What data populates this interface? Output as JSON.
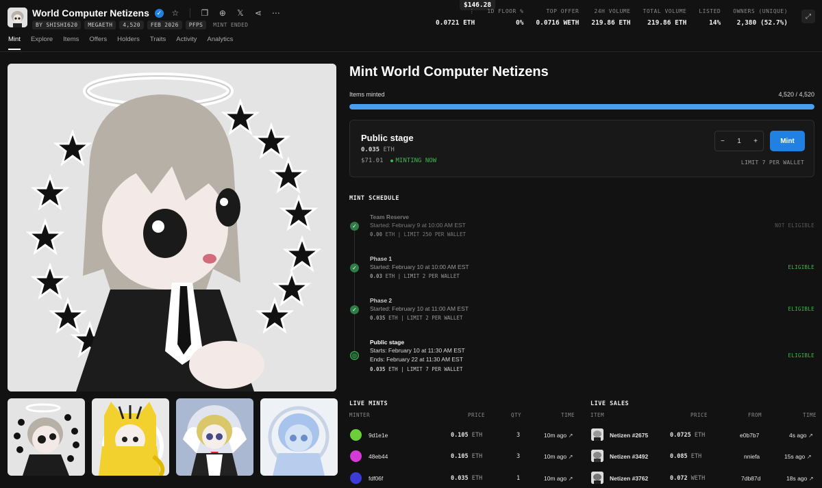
{
  "header": {
    "collection_name": "World Computer Netizens",
    "badges": [
      "BY SHISHI620",
      "MEGAETH",
      "4,520",
      "FEB 2026",
      "PFPS",
      "MINT ENDED"
    ],
    "tooltip": "$146.28",
    "stats": [
      {
        "label": "",
        "value": "0.0721 ETH"
      },
      {
        "label": "1D FLOOR %",
        "value": "0%"
      },
      {
        "label": "TOP OFFER",
        "value": "0.0716 WETH"
      },
      {
        "label": "24H VOLUME",
        "value": "219.86 ETH"
      },
      {
        "label": "TOTAL VOLUME",
        "value": "219.86 ETH"
      },
      {
        "label": "LISTED",
        "value": "14%"
      },
      {
        "label": "OWNERS (UNIQUE)",
        "value": "2,380 (52.7%)"
      }
    ]
  },
  "nav": [
    "Mint",
    "Explore",
    "Items",
    "Offers",
    "Holders",
    "Traits",
    "Activity",
    "Analytics"
  ],
  "mint": {
    "title": "Mint World Computer Netizens",
    "items_minted_label": "Items minted",
    "items_minted_value": "4,520 / 4,520",
    "progress": 1.0,
    "stage": {
      "name": "Public stage",
      "price": "0.035",
      "price_unit": "ETH",
      "usd": "$71.01",
      "status": "MINTING NOW",
      "quantity": "1",
      "minus": "−",
      "plus": "+",
      "mint_label": "Mint",
      "limit": "LIMIT 7 PER WALLET"
    }
  },
  "schedule": {
    "title": "MINT SCHEDULE",
    "phases": [
      {
        "name": "Team Reserve",
        "line1": "Started: February 9 at 10:00 AM EST",
        "line2_price": "0.00",
        "line2_rest": "ETH | LIMIT 250 PER WALLET",
        "status": "NOT ELIGIBLE"
      },
      {
        "name": "Phase 1",
        "line1": "Started: February 10 at 10:00 AM EST",
        "line2_price": "0.03",
        "line2_rest": "ETH | LIMIT 2 PER WALLET",
        "status": "ELIGIBLE"
      },
      {
        "name": "Phase 2",
        "line1": "Started: February 10 at 11:00 AM EST",
        "line2_price": "0.035",
        "line2_rest": "ETH | LIMIT 2 PER WALLET",
        "status": "ELIGIBLE"
      },
      {
        "name": "Public stage",
        "line1": "Starts: February 10 at 11:30 AM EST",
        "line1b": "Ends: February 22 at 11:30 AM EST",
        "line2_price": "0.035",
        "line2_rest": "ETH | LIMIT 7 PER WALLET",
        "status": "ELIGIBLE"
      }
    ]
  },
  "live_mints": {
    "title": "LIVE MINTS",
    "headers": [
      "MINTER",
      "PRICE",
      "QTY",
      "TIME"
    ],
    "rows": [
      {
        "minter": "9d1e1e",
        "price": "0.105",
        "unit": "ETH",
        "qty": "3",
        "time": "10m ago",
        "color": "#6ccf3a"
      },
      {
        "minter": "48eb44",
        "price": "0.105",
        "unit": "ETH",
        "qty": "3",
        "time": "10m ago",
        "color": "#d53ad8"
      },
      {
        "minter": "fdf06f",
        "price": "0.035",
        "unit": "ETH",
        "qty": "1",
        "time": "10m ago",
        "color": "#3b3bd8"
      }
    ]
  },
  "live_sales": {
    "title": "LIVE SALES",
    "headers": [
      "ITEM",
      "PRICE",
      "FROM",
      "TIME"
    ],
    "rows": [
      {
        "item": "Netizen #2675",
        "price": "0.0725",
        "unit": "ETH",
        "from": "e0b7b7",
        "time": "4s ago"
      },
      {
        "item": "Netizen #3492",
        "price": "0.085",
        "unit": "ETH",
        "from": "nniefa",
        "time": "15s ago"
      },
      {
        "item": "Netizen #3762",
        "price": "0.072",
        "unit": "WETH",
        "from": "7db87d",
        "time": "18s ago"
      }
    ]
  },
  "colors": {
    "accent": "#2081e2",
    "eligible": "#3fb950",
    "progress": "#4a9ef0"
  }
}
